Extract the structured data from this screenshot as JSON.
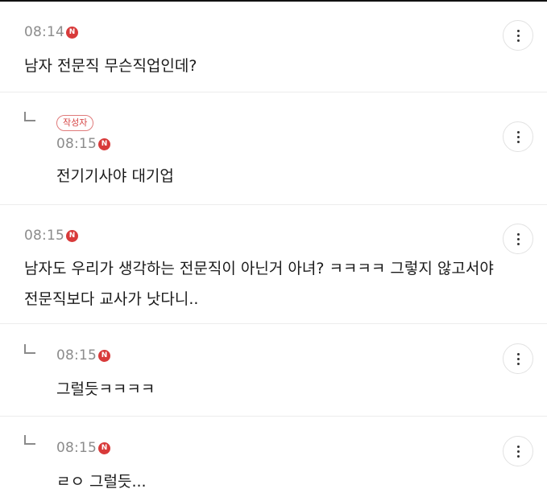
{
  "badges": {
    "naver": "N",
    "author": "작성자"
  },
  "comments": [
    {
      "time": "08:14",
      "text": "남자 전문직 무슨직업인데?"
    },
    {
      "time": "08:15",
      "text": "전기기사야 대기업"
    },
    {
      "time": "08:15",
      "text": "남자도 우리가 생각하는 전문직이 아닌거 아녀? ㅋㅋㅋㅋ 그렇지 않고서야 전문직보다 교사가 낫다니.."
    },
    {
      "time": "08:15",
      "text": "그럴듯ㅋㅋㅋㅋ"
    },
    {
      "time": "08:15",
      "text": "ㄹㅇ 그럴듯..."
    }
  ]
}
